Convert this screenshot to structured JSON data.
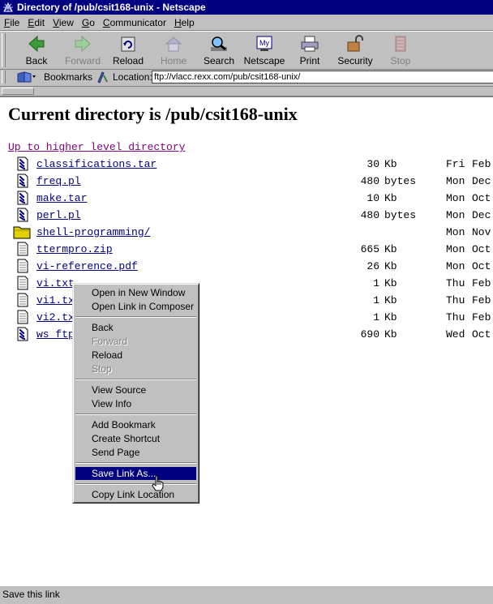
{
  "window": {
    "title": "Directory of /pub/csit168-unix - Netscape"
  },
  "menu": [
    {
      "label": "File",
      "u": "F",
      "rest": "ile"
    },
    {
      "label": "Edit",
      "u": "E",
      "rest": "dit"
    },
    {
      "label": "View",
      "u": "V",
      "rest": "iew"
    },
    {
      "label": "Go",
      "u": "G",
      "rest": "o"
    },
    {
      "label": "Communicator",
      "u": "C",
      "rest": "ommunicator"
    },
    {
      "label": "Help",
      "u": "H",
      "rest": "elp"
    }
  ],
  "toolbar": {
    "back": "Back",
    "forward": "Forward",
    "reload": "Reload",
    "home": "Home",
    "search": "Search",
    "netscape": "Netscape",
    "print": "Print",
    "security": "Security",
    "stop": "Stop"
  },
  "location": {
    "bookmarks_label": "Bookmarks",
    "location_label": "Location:",
    "url": "ftp://vlacc.rexx.com/pub/csit168-unix/"
  },
  "page": {
    "heading": "Current directory is /pub/csit168-unix",
    "up_link": "Up to higher level directory",
    "files": [
      {
        "name": "classifications.tar",
        "icon": "binary-file-icon",
        "size": "30",
        "unit": "Kb",
        "day": "Fri",
        "mon": "Feb"
      },
      {
        "name": "freq.pl",
        "icon": "binary-file-icon",
        "size": "480",
        "unit": "bytes",
        "day": "Mon",
        "mon": "Dec"
      },
      {
        "name": "make.tar",
        "icon": "binary-file-icon",
        "size": "10",
        "unit": "Kb",
        "day": "Mon",
        "mon": "Oct"
      },
      {
        "name": "perl.pl",
        "icon": "binary-file-icon",
        "size": "480",
        "unit": "bytes",
        "day": "Mon",
        "mon": "Dec"
      },
      {
        "name": "shell-programming/",
        "icon": "folder-icon",
        "size": "",
        "unit": "",
        "day": "Mon",
        "mon": "Nov"
      },
      {
        "name": "ttermpro.zip",
        "icon": "text-file-icon",
        "size": "665",
        "unit": "Kb",
        "day": "Mon",
        "mon": "Oct"
      },
      {
        "name": "vi-reference.pdf",
        "icon": "text-file-icon",
        "size": "26",
        "unit": "Kb",
        "day": "Mon",
        "mon": "Oct"
      },
      {
        "name": "vi.txt",
        "icon": "text-file-icon",
        "size": "1",
        "unit": "Kb",
        "day": "Thu",
        "mon": "Feb"
      },
      {
        "name": "vi1.txt",
        "icon": "text-file-icon",
        "size": "1",
        "unit": "Kb",
        "day": "Thu",
        "mon": "Feb"
      },
      {
        "name": "vi2.txt",
        "icon": "text-file-icon",
        "size": "1",
        "unit": "Kb",
        "day": "Thu",
        "mon": "Feb"
      },
      {
        "name": "ws_ftp",
        "icon": "binary-file-icon",
        "size": "690",
        "unit": "Kb",
        "day": "Wed",
        "mon": "Oct"
      }
    ]
  },
  "context_menu": {
    "open_new_window": "Open in New Window",
    "open_composer": "Open Link in Composer",
    "back": "Back",
    "forward": "Forward",
    "reload": "Reload",
    "stop": "Stop",
    "view_source": "View Source",
    "view_info": "View Info",
    "add_bookmark": "Add Bookmark",
    "create_shortcut": "Create Shortcut",
    "send_page": "Send Page",
    "save_link_as": "Save Link As...",
    "copy_link_location": "Copy Link Location"
  },
  "status": {
    "text": "Save this link"
  },
  "colors": {
    "title_bg": "#000080",
    "link": "#000080",
    "visited_link": "#800080",
    "menu_highlight": "#000080"
  }
}
